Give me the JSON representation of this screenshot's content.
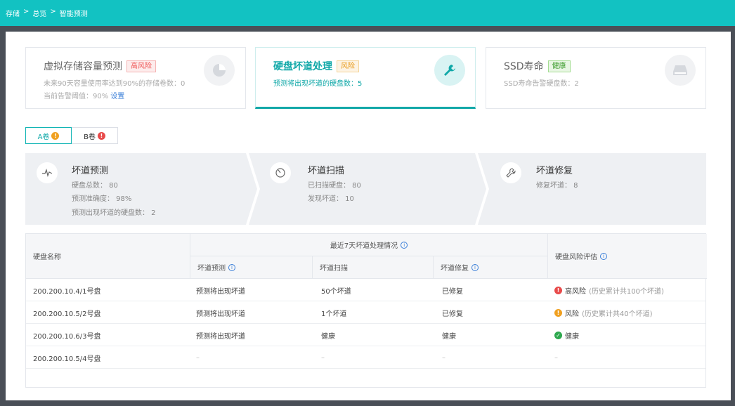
{
  "breadcrumb": [
    "存储",
    ">",
    "总览",
    ">",
    "智能预测"
  ],
  "cards": [
    {
      "title": "虚拟存储容量预测",
      "tag": "高风险",
      "lines": [
        "未来90天容量使用率达到90%的存储卷数：0",
        "当前告警阈值：90%"
      ],
      "link": "设置",
      "icon": "pie-chart-icon"
    },
    {
      "title": "硬盘坏道处理",
      "tag": "风险",
      "lines": [
        "预测将出现坏道的硬盘数：5"
      ],
      "icon": "wrench-icon"
    },
    {
      "title": "SSD寿命",
      "tag": "健康",
      "lines": [
        "SSD寿命告警硬盘数：2"
      ],
      "icon": "disk-drive-icon"
    }
  ],
  "volume_tabs": [
    {
      "label": "A卷",
      "badge": "!"
    },
    {
      "label": "B卷",
      "badge": "!"
    }
  ],
  "steps": [
    {
      "title": "坏道预测",
      "lines": [
        "硬盘总数：  80",
        "预测准确度：  98%",
        "预测出现坏道的硬盘数：  2"
      ],
      "icon": "pulse-icon"
    },
    {
      "title": "坏道扫描",
      "lines": [
        "已扫描硬盘：  80",
        "发现坏道：  10"
      ],
      "icon": "scan-icon"
    },
    {
      "title": "坏道修复",
      "lines": [
        "修复坏道：  8"
      ],
      "icon": "wrench-icon"
    }
  ],
  "table": {
    "headers": {
      "name": "硬盘名称",
      "group": "最近7天坏道处理情况",
      "predict": "坏道预测",
      "scan": "坏道扫描",
      "repair": "坏道修复",
      "risk": "硬盘风险评估"
    },
    "rows": [
      {
        "name": "200.200.10.4/1号盘",
        "predict": "预测将出现坏道",
        "scan": "50个坏道",
        "repair": "已修复",
        "risk": "高风险",
        "risk_note": "(历史累计共100个坏道)"
      },
      {
        "name": "200.200.10.5/2号盘",
        "predict": "预测将出现坏道",
        "scan": "1个坏道",
        "repair": "已修复",
        "risk": "风险",
        "risk_note": "(历史累计共40个坏道)"
      },
      {
        "name": "200.200.10.6/3号盘",
        "predict": "预测将出现坏道",
        "scan": "健康",
        "repair": "健康",
        "risk": "健康",
        "risk_note": ""
      },
      {
        "name": "200.200.10.5/4号盘",
        "predict": "–",
        "scan": "–",
        "repair": "–",
        "risk": "–",
        "risk_note": ""
      }
    ]
  },
  "colors": {
    "accent": "#12c2c2",
    "high_risk": "#e84a4a",
    "risk": "#f0a020",
    "healthy": "#2ea84e",
    "link": "#3b7fd8"
  }
}
